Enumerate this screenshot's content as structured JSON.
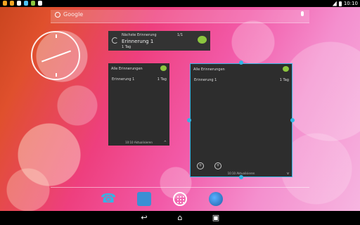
{
  "statusbar": {
    "time": "10:10",
    "icons": [
      "notification-icon",
      "notification-icon",
      "notification-icon",
      "notification-icon",
      "notification-icon",
      "notification-icon"
    ]
  },
  "search": {
    "placeholder": "Google"
  },
  "widgets": {
    "next_reminder": {
      "title": "Nächste Erinnerung",
      "counter": "1/1",
      "name": "Erinnerung 1",
      "due": "1 Tag"
    },
    "all_reminders_small": {
      "title": "Alle Erinnerungen",
      "items": [
        {
          "name": "Erinnerung 1",
          "due": "1 Tag"
        }
      ],
      "footer": "10:10 Aktualisieren"
    },
    "all_reminders_large": {
      "title": "Alle Erinnerungen",
      "items": [
        {
          "name": "Erinnerung 1",
          "due": "1 Tag"
        }
      ],
      "footer": "10:10 Aktualisieren"
    }
  },
  "colors": {
    "accent": "#33b5e5",
    "widget_bg": "#2d2d2d",
    "app_icon": "#8cc63f"
  },
  "dock": [
    "phone-icon",
    "contacts-icon",
    "apps-icon",
    "browser-icon"
  ],
  "navbar": [
    "back-icon",
    "home-icon",
    "recents-icon"
  ]
}
